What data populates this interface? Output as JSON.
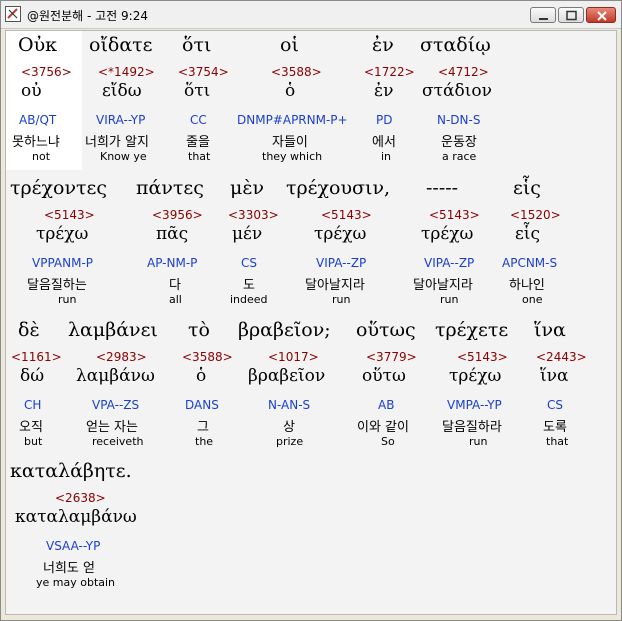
{
  "window": {
    "title": "@원전분해 - 고전 9:24"
  },
  "words": [
    {
      "greek": "Οὐκ",
      "strong": "<3756>",
      "lemma": "οὐ",
      "parse": "AB/QT",
      "korean": "못하느냐",
      "english": "not"
    },
    {
      "greek": "οἴδατε",
      "strong": "<*1492>",
      "lemma": "εἴδω",
      "parse": "VIRA--YP",
      "korean": "너희가 알지",
      "english": "Know ye"
    },
    {
      "greek": "ὅτι",
      "strong": "<3754>",
      "lemma": "ὅτι",
      "parse": "CC",
      "korean": "줄을",
      "english": "that"
    },
    {
      "greek": "οἱ",
      "strong": "<3588>",
      "lemma": "ὁ",
      "parse": "DNMP#APRNM-P+",
      "korean": "자들이",
      "english": "they which"
    },
    {
      "greek": "ἐν",
      "strong": "<1722>",
      "lemma": "ἐν",
      "parse": "PD",
      "korean": "에서",
      "english": "in"
    },
    {
      "greek": "σταδίῳ",
      "strong": "<4712>",
      "lemma": "στάδιον",
      "parse": "N-DN-S",
      "korean": "운동장",
      "english": "a race"
    },
    {
      "greek": "τρέχοντες",
      "strong": "<5143>",
      "lemma": "τρέχω",
      "parse": "VPPANM-P",
      "korean": "달음질하는",
      "english": "run"
    },
    {
      "greek": "πάντες",
      "strong": "<3956>",
      "lemma": "πᾶς",
      "parse": "AP-NM-P",
      "korean": "다",
      "english": "all"
    },
    {
      "greek": "μὲν",
      "strong": "<3303>",
      "lemma": "μέν",
      "parse": "CS",
      "korean": "도",
      "english": "indeed"
    },
    {
      "greek": "τρέχουσιν,",
      "strong": "<5143>",
      "lemma": "τρέχω",
      "parse": "VIPA--ZP",
      "korean": "달아날지라",
      "english": "run"
    },
    {
      "greek": "-----",
      "strong": "<5143>",
      "lemma": "τρέχω",
      "parse": "VIPA--ZP",
      "korean": "달아날지라",
      "english": "run"
    },
    {
      "greek": "εἷς",
      "strong": "<1520>",
      "lemma": "εἷς",
      "parse": "APCNM-S",
      "korean": "하나인",
      "english": "one"
    },
    {
      "greek": "δὲ",
      "strong": "<1161>",
      "lemma": "δώ",
      "parse": "CH",
      "korean": "오직",
      "english": "but"
    },
    {
      "greek": "λαμβάνει",
      "strong": "<2983>",
      "lemma": "λαμβάνω",
      "parse": "VPA--ZS",
      "korean": "얻는 자는",
      "english": "receiveth"
    },
    {
      "greek": "τὸ",
      "strong": "<3588>",
      "lemma": "ὁ",
      "parse": "DANS",
      "korean": "그",
      "english": "the"
    },
    {
      "greek": "βραβεῖον;",
      "strong": "<1017>",
      "lemma": "βραβεῖον",
      "parse": "N-AN-S",
      "korean": "상",
      "english": "prize"
    },
    {
      "greek": "οὕτως",
      "strong": "<3779>",
      "lemma": "οὕτω",
      "parse": "AB",
      "korean": "이와 같이",
      "english": "So"
    },
    {
      "greek": "τρέχετε",
      "strong": "<5143>",
      "lemma": "τρέχω",
      "parse": "VMPA--YP",
      "korean": "달음질하라",
      "english": "run"
    },
    {
      "greek": "ἵνα",
      "strong": "<2443>",
      "lemma": "ἵνα",
      "parse": "CS",
      "korean": "도록",
      "english": "that"
    },
    {
      "greek": "καταλάβητε.",
      "strong": "<2638>",
      "lemma": "καταλαμβάνω",
      "parse": "VSAA--YP",
      "korean": "너희도 얻",
      "english": "ye may obtain"
    }
  ]
}
